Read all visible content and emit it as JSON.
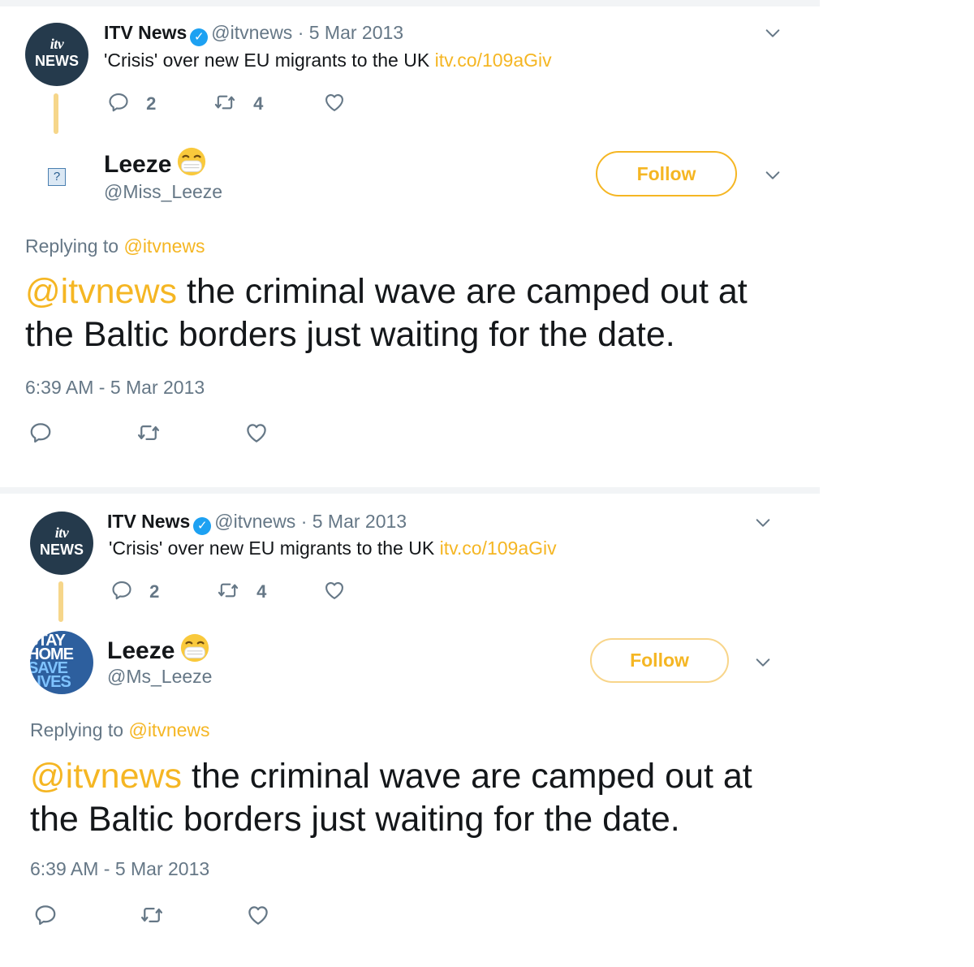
{
  "tweets": [
    {
      "parent": {
        "name": "ITV News",
        "handle": "@itvnews",
        "date": "· 5 Mar 2013",
        "text": "'Crisis' over new EU migrants to the UK",
        "link": "itv.co/109aGiv",
        "avatar_top": "itv",
        "avatar_bottom": "NEWS",
        "replies": "2",
        "retweets": "4"
      },
      "reply": {
        "name": "Leeze",
        "handle": "@Miss_Leeze",
        "follow_label": "Follow",
        "replying_prefix": "Replying to",
        "replying_handle": "@itvnews",
        "mention": "@itvnews",
        "text": " the criminal wave are camped out at the Baltic borders just waiting for the date.",
        "timestamp": "6:39 AM - 5 Mar 2013",
        "avatar_placeholder": "?"
      }
    },
    {
      "parent": {
        "name": "ITV News",
        "handle": "@itvnews",
        "date": "· 5 Mar 2013",
        "text": "'Crisis' over new EU migrants to the UK",
        "link": "itv.co/109aGiv",
        "avatar_top": "itv",
        "avatar_bottom": "NEWS",
        "replies": "2",
        "retweets": "4"
      },
      "reply": {
        "name": "Leeze",
        "handle": "@Ms_Leeze",
        "follow_label": "Follow",
        "replying_prefix": "Replying to",
        "replying_handle": "@itvnews",
        "mention": "@itvnews",
        "text": " the criminal wave are camped out at the Baltic borders just waiting for the date.",
        "timestamp": "6:39 AM - 5 Mar 2013",
        "avatar_lines": [
          "STAY",
          "HOME",
          "SAVE",
          "LIVES"
        ]
      }
    }
  ],
  "colors": {
    "accent": "#f5b623",
    "muted": "#657786",
    "text": "#14171a",
    "verified": "#1da1f2",
    "itv_avatar": "#253a4c",
    "thread_line": "#f6d68a"
  },
  "icons": [
    "verified-icon",
    "reply-icon",
    "retweet-icon",
    "like-icon",
    "chevron-down-icon",
    "mask-emoji-icon"
  ]
}
